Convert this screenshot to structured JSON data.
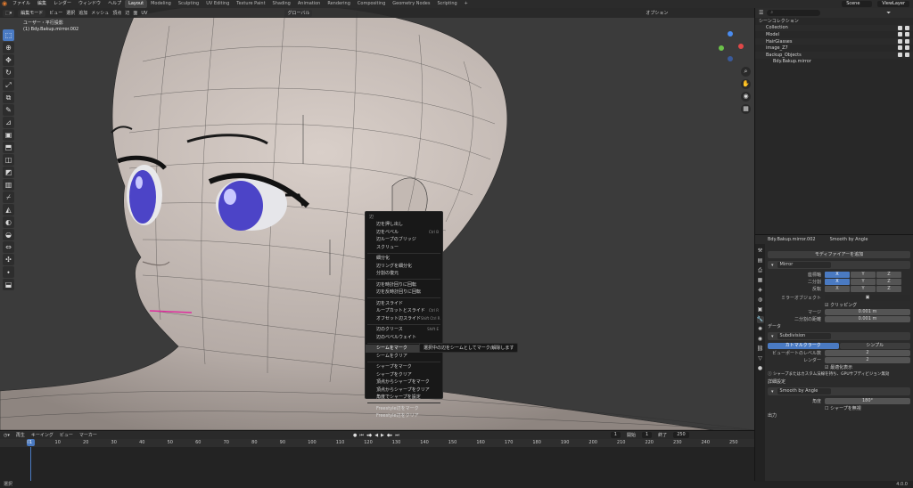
{
  "topbar": {
    "menus": [
      "ファイル",
      "編集",
      "レンダー",
      "ウィンドウ",
      "ヘルプ"
    ],
    "workspaces": [
      "Layout",
      "Modeling",
      "Sculpting",
      "UV Editing",
      "Texture Paint",
      "Shading",
      "Animation",
      "Rendering",
      "Compositing",
      "Geometry Nodes",
      "Scripting",
      "+"
    ],
    "active_workspace": "Layout",
    "scene": "Scene",
    "view_layer": "ViewLayer"
  },
  "viewport": {
    "mode": "編集モード",
    "header_menus": [
      "ビュー",
      "選択",
      "追加",
      "メッシュ",
      "頂点",
      "辺",
      "面",
      "UV"
    ],
    "orientation": "グローバル",
    "options": "オプション",
    "view_name": "ユーザー・平行投影",
    "object_name": "(1) Bdy.Bakup.mirror.002"
  },
  "context_menu": {
    "title": "辺",
    "items": [
      {
        "label": "辺を押し出し",
        "shortcut": ""
      },
      {
        "label": "辺をベベル",
        "shortcut": "Ctrl B"
      },
      {
        "label": "辺ループのブリッジ",
        "shortcut": ""
      },
      {
        "label": "スクリュー",
        "shortcut": ""
      },
      {
        "label": "細分化",
        "shortcut": ""
      },
      {
        "label": "辺リングを細分化",
        "shortcut": ""
      },
      {
        "label": "分割の復元",
        "shortcut": ""
      },
      {
        "label": "辺を時計回りに回転",
        "shortcut": ""
      },
      {
        "label": "辺を反時計回りに回転",
        "shortcut": ""
      },
      {
        "label": "辺をスライド",
        "shortcut": ""
      },
      {
        "label": "ループカットとスライド",
        "shortcut": "Ctrl R"
      },
      {
        "label": "オフセット辺スライド",
        "shortcut": "Shift Ctrl R"
      },
      {
        "label": "辺のクリース",
        "shortcut": "Shift E"
      },
      {
        "label": "辺のベベルウェイト",
        "shortcut": ""
      },
      {
        "label": "シームをマーク",
        "shortcut": ""
      },
      {
        "label": "シームをクリア",
        "shortcut": ""
      },
      {
        "label": "シャープをマーク",
        "shortcut": ""
      },
      {
        "label": "シャープをクリア",
        "shortcut": ""
      },
      {
        "label": "頂点からシャープをマーク",
        "shortcut": ""
      },
      {
        "label": "頂点からシャープをクリア",
        "shortcut": ""
      },
      {
        "label": "角度でシャープを設定",
        "shortcut": ""
      },
      {
        "label": "Freestyle辺をマーク",
        "shortcut": ""
      },
      {
        "label": "Freestyle辺をクリア",
        "shortcut": ""
      }
    ],
    "highlighted": "シームをマーク",
    "tooltip": "選択中の辺をシームとしてマーク/解除します"
  },
  "timeline": {
    "menus": [
      "再生",
      "キーイング",
      "ビュー",
      "マーカー"
    ],
    "current_frame": "1",
    "start_label": "開始",
    "start": "1",
    "end_label": "終了",
    "end": "250",
    "ticks": [
      "0",
      "10",
      "20",
      "30",
      "40",
      "50",
      "60",
      "70",
      "80",
      "90",
      "100",
      "110",
      "120",
      "130",
      "140",
      "150",
      "160",
      "170",
      "180",
      "190",
      "200",
      "210",
      "220",
      "230",
      "240",
      "250"
    ],
    "cursor": "1"
  },
  "statusbar": {
    "left": "選択",
    "version": "4.0.0"
  },
  "outliner": {
    "title": "シーンコレクション",
    "rows": [
      "Collection",
      "Model",
      "HairGlasses",
      "image_Z7",
      "Backup_Objects",
      "Bdy.Bakup.mirror"
    ]
  },
  "properties": {
    "search_placeholder": "",
    "object": "Bdy.Bakup.mirror.002",
    "modifier_pin": "Smooth by Angle",
    "add_modifier": "モディファイアーを追加",
    "mirror": {
      "name": "Mirror",
      "axis_label": "座標軸",
      "bisect_label": "二分割",
      "flip_label": "反転",
      "axes": [
        "X",
        "Y",
        "Z"
      ],
      "mirror_object_label": "ミラーオブジェクト",
      "clipping": "クリッピング",
      "merge_label": "マージ",
      "merge_value": "0.001 m",
      "bisect_distance_label": "二分割の距離",
      "bisect_distance_value": "0.001 m",
      "data_label": "データ"
    },
    "subsurf": {
      "name": "Subdivision",
      "mode_a": "カトマルクラーク",
      "mode_b": "シンプル",
      "viewport_levels_label": "ビューポートのレベル数",
      "viewport_levels": "2",
      "render_label": "レンダー",
      "render_levels": "2",
      "optimal_display": "最適化表示",
      "info": "シャープまたはカスタム法線を持ち、GPUサブディビジョン無効",
      "advanced": "詳細設定"
    },
    "smooth": {
      "name": "Smooth by Angle",
      "angle_label": "角度",
      "angle_value": "180°",
      "ignore_sharp": "シャープを無視",
      "output": "出力"
    }
  }
}
